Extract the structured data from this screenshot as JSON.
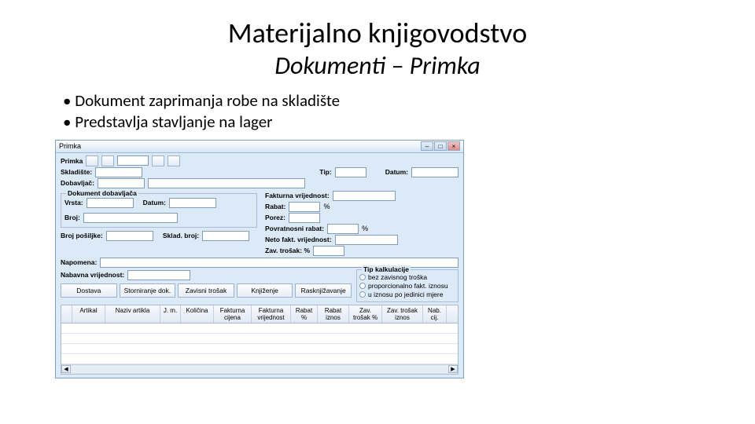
{
  "slide": {
    "title": "Materijalno knjigovodstvo",
    "subtitle": "Dokumenti – Primka",
    "bullets": [
      "Dokument zaprimanja robe na skladište",
      "Predstavlja stavljanje na lager"
    ]
  },
  "window": {
    "title": "Primka",
    "controls": {
      "min": "–",
      "max": "□",
      "close": "×"
    }
  },
  "toolbar": {
    "primka_label": "Primka",
    "nav": {
      "first": "|◀",
      "prev": "◀",
      "next": "▶",
      "last": "▶|"
    }
  },
  "form": {
    "skladiste_label": "Skladište:",
    "tip_label": "Tip:",
    "datum_label": "Datum:",
    "dobavljac_label": "Dobavljač:",
    "sup_doc_legend": "Dokument dobavljača",
    "vrsta_label": "Vrsta:",
    "datum2_label": "Datum:",
    "broj_label": "Broj:",
    "brojposilike_label": "Broj pošiljke:",
    "sklad_broj_label": "Sklad. broj:",
    "napomena_label": "Napomena:",
    "fakt_vrij_label": "Fakturna vrijednost:",
    "rabat_label": "Rabat:",
    "rabat_pct": "%",
    "porez_label": "Porez:",
    "povrat_rabat_label": "Povratnosni rabat:",
    "povrat_rabat_pct": "%",
    "neto_label": "Neto fakt. vrijednost:",
    "zav_trosak_label": "Zav. trošak: %",
    "nabavna_label": "Nabavna vrijednost:"
  },
  "calcbox": {
    "legend": "Tip kalkulacije",
    "opt1": "bez zavisnog troška",
    "opt2": "proporcionalno fakt. iznosu",
    "opt3": "u iznosu po jedinici mjere"
  },
  "buttons": {
    "dostava": "Dostava",
    "storno": "Storniranje dok.",
    "zavtr": "Zavisni trošak",
    "knjizenje": "Knjiženje",
    "rasknj": "Rasknjižavanje"
  },
  "grid": {
    "cols": [
      "",
      "Artikal",
      "Naziv artikla",
      "J. m.",
      "Količina",
      "Fakturna cijena",
      "Fakturna vrijednost",
      "Rabat %",
      "Rabat iznos",
      "Zav. trošak %",
      "Zav. trošak iznos",
      "Nab. cij."
    ]
  }
}
